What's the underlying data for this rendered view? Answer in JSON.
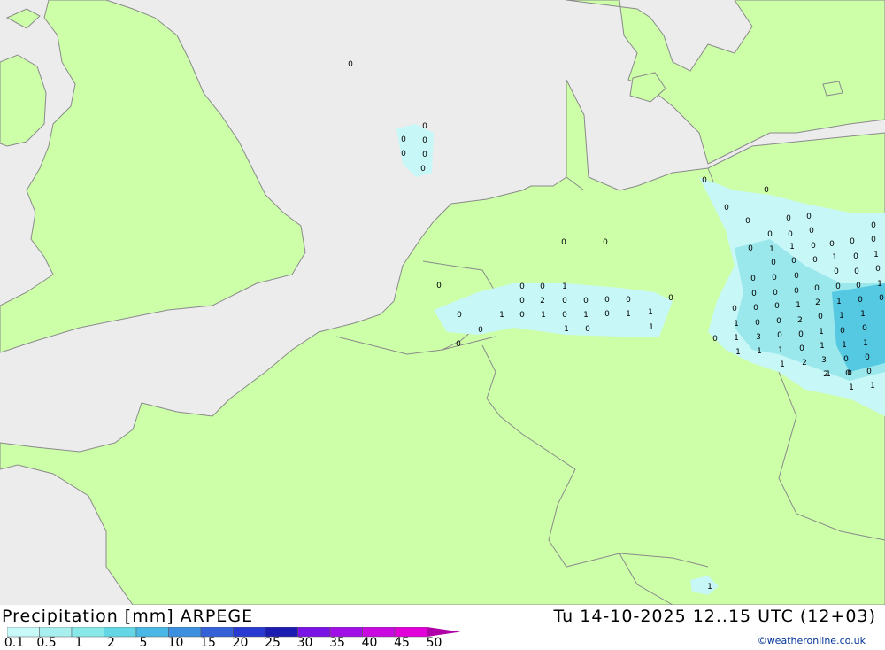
{
  "map": {
    "colors": {
      "sea": "#ececec",
      "land": "#ccffa8",
      "border": "#8a8a8a",
      "precip_light": "#c8f7f7",
      "precip_mid": "#9ae7ec",
      "precip_heavy": "#55c8e2"
    },
    "value_labels": [
      "0",
      "0",
      "0",
      "0",
      "0",
      "0",
      "0",
      "0",
      "0",
      "0",
      "0",
      "0",
      "0",
      "0",
      "0",
      "0",
      "0",
      "0",
      "0",
      "0",
      "0",
      "0",
      "0",
      "1",
      "1",
      "0",
      "1",
      "0",
      "1",
      "0",
      "0",
      "0",
      "0",
      "0",
      "0",
      "0",
      "0",
      "0",
      "1",
      "0",
      "0",
      "0",
      "0",
      "0",
      "0",
      "1",
      "0",
      "0",
      "2",
      "0",
      "0",
      "0",
      "0",
      "0",
      "0",
      "0",
      "2",
      "1",
      "0",
      "0",
      "0",
      "1",
      "0",
      "1",
      "0",
      "1",
      "0",
      "1",
      "1",
      "0",
      "0",
      "0",
      "1",
      "0",
      "1",
      "1",
      "1",
      "0",
      "0",
      "2",
      "1",
      "0",
      "0",
      "1",
      "0",
      "1",
      "0",
      "1",
      "3",
      "0",
      "0",
      "1",
      "1",
      "1",
      "0",
      "0",
      "1",
      "1",
      "1",
      "0",
      "3",
      "0",
      "0",
      "1",
      "2",
      "2",
      "0",
      "0",
      "1",
      "1",
      "1",
      "0",
      "1"
    ]
  },
  "footer": {
    "title_left": "Precipitation [mm] ARPEGE",
    "title_right": "Tu 14-10-2025 12..15 UTC (12+03)",
    "credit": "©weatheronline.co.uk"
  },
  "legend": {
    "labels": [
      "0.1",
      "0.5",
      "1",
      "2",
      "5",
      "10",
      "15",
      "20",
      "25",
      "30",
      "35",
      "40",
      "45",
      "50"
    ],
    "colors": [
      "#c8fafa",
      "#a8f0f0",
      "#88e8ea",
      "#64d6e6",
      "#4ab8e4",
      "#3d8fe0",
      "#3460d8",
      "#2a3ad0",
      "#1c1cb0",
      "#7a14e6",
      "#a010e6",
      "#c80ae0",
      "#e000d8",
      "#b000a8"
    ]
  }
}
